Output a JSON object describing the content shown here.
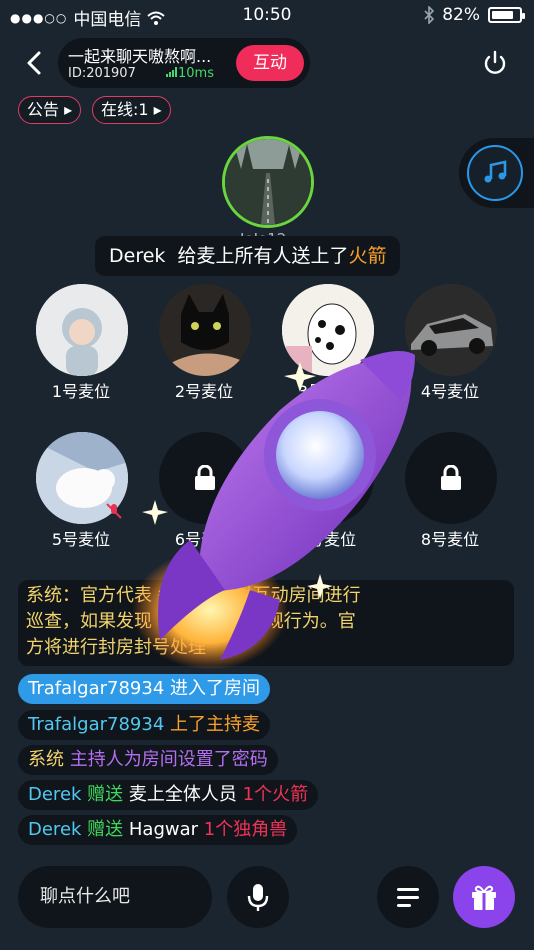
{
  "status_bar": {
    "signal_dots": "●●●○○",
    "carrier": "中国电信",
    "time": "10:50",
    "battery": "82%",
    "battery_level": 0.82
  },
  "header": {
    "room_title": "一起来聊天嗷熬啊...",
    "room_id": "ID:201907",
    "ping": "10ms",
    "interact_label": "互动"
  },
  "tags": [
    {
      "label": "公告"
    },
    {
      "label": "在线:1"
    }
  ],
  "host": {
    "name": "JoJo12"
  },
  "gift_banner": {
    "sender": "Derek",
    "text": "给麦上所有人送上了",
    "gift": "火箭"
  },
  "seats": [
    {
      "label": "1号麦位"
    },
    {
      "label": "2号麦位"
    },
    {
      "label": "3号麦位"
    },
    {
      "label": "4号麦位"
    },
    {
      "label": "5号麦位"
    },
    {
      "label": "6号麦位"
    },
    {
      "label": "7号麦位"
    },
    {
      "label": "8号麦位"
    }
  ],
  "system_message": {
    "line1": "系统：官方代表 每24小时对互动房间进行",
    "line2": "巡查，如果发现 人身攻击等违规行为。官",
    "line3": "方将进行封房封号处理"
  },
  "chat": [
    {
      "user": "Trafalgar78934",
      "text": " 进入了房间"
    },
    {
      "user": "Trafalgar78934",
      "text": " 上了主持麦"
    },
    {
      "user": "系统",
      "text": " 主持人为房间设置了密码"
    },
    {
      "user": "Derek",
      "verb": " 赠送",
      "target": " 麦上全体人员",
      "gift": " 1个火箭"
    },
    {
      "user": "Derek",
      "verb": " 赠送",
      "target": " Hagwar",
      "gift": " 1个独角兽"
    }
  ],
  "input": {
    "placeholder": "聊点什么吧"
  },
  "colors": {
    "background": "#1b2530",
    "pill": "#0f151b",
    "accent_red": "#ef2c5a",
    "host_ring": "#6bd53d",
    "gift_purple": "#8b43ec",
    "music_blue": "#2a98e8"
  }
}
